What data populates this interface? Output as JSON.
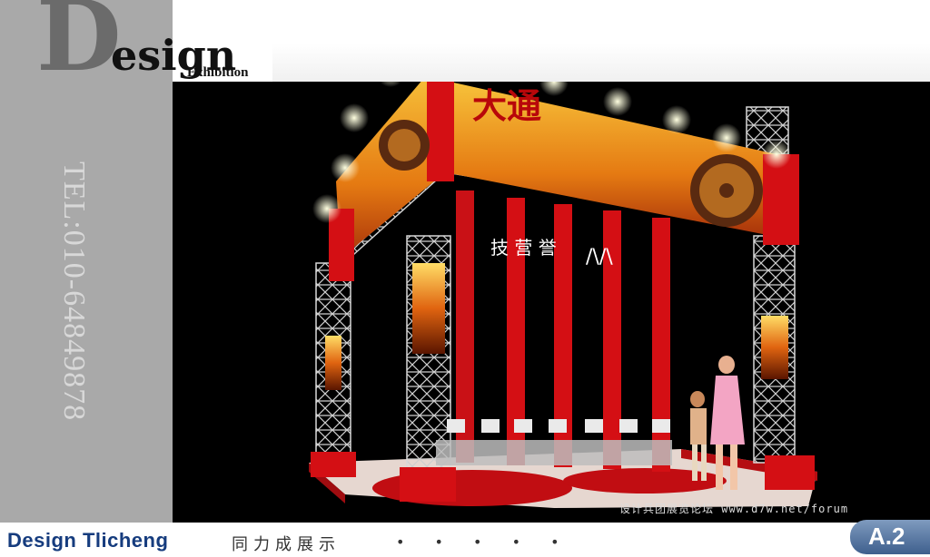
{
  "logo": {
    "big_letter": "D",
    "word": "esign",
    "sub": "Exhibition"
  },
  "sidebar": {
    "tel": "TEL:010-64849878"
  },
  "booth": {
    "screen_count": 7,
    "banner_text": "大通",
    "colors": {
      "red": "#d40f14",
      "truss": "#d8d8d8",
      "banner": "#f0a020",
      "floor": "#e8d9d0"
    }
  },
  "watermark": "设计兵团展览论坛 www.d7w.net/forum",
  "footer": {
    "brand": "Design Tlicheng",
    "brand_cn": "同力成展示",
    "dots": "• • • • •"
  },
  "badge": {
    "label": "A.2"
  }
}
